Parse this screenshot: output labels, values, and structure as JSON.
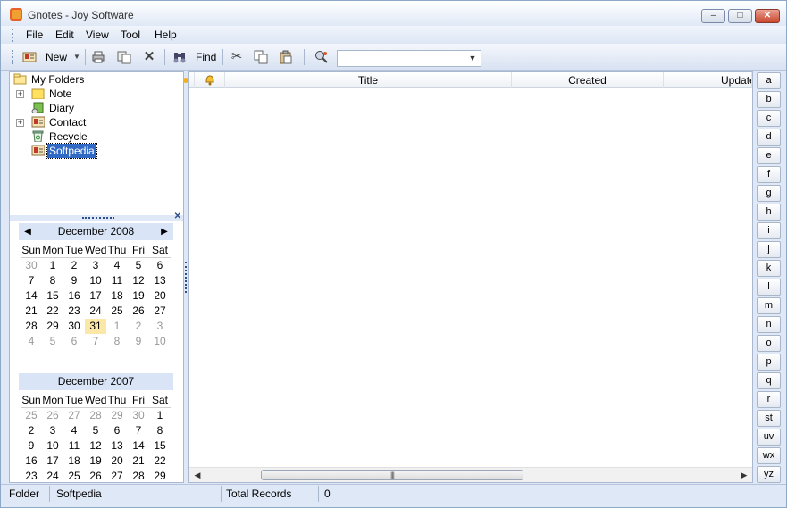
{
  "window": {
    "title": "Gnotes - Joy Software"
  },
  "menu": [
    "File",
    "Edit",
    "View",
    "Tool",
    "Help"
  ],
  "toolbar": {
    "new_label": "New",
    "find_label": "Find",
    "combo_value": ""
  },
  "tree": {
    "root": "My Folders",
    "items": [
      {
        "label": "Note",
        "icon": "folder-icon",
        "expandable": true
      },
      {
        "label": "Diary",
        "icon": "diary-icon",
        "expandable": false
      },
      {
        "label": "Contact",
        "icon": "contact-card-icon",
        "expandable": true
      },
      {
        "label": "Recycle",
        "icon": "recycle-bin-icon",
        "expandable": false
      },
      {
        "label": "Softpedia",
        "icon": "contact-card-icon",
        "expandable": false,
        "selected": true
      }
    ]
  },
  "calendar": [
    {
      "month": "December 2008",
      "dow": [
        "Sun",
        "Mon",
        "Tue",
        "Wed",
        "Thu",
        "Fri",
        "Sat"
      ],
      "weeks": [
        [
          "30",
          "1",
          "2",
          "3",
          "4",
          "5",
          "6"
        ],
        [
          "7",
          "8",
          "9",
          "10",
          "11",
          "12",
          "13"
        ],
        [
          "14",
          "15",
          "16",
          "17",
          "18",
          "19",
          "20"
        ],
        [
          "21",
          "22",
          "23",
          "24",
          "25",
          "26",
          "27"
        ],
        [
          "28",
          "29",
          "30",
          "31",
          "1",
          "2",
          "3"
        ],
        [
          "4",
          "5",
          "6",
          "7",
          "8",
          "9",
          "10"
        ]
      ],
      "today": "31"
    },
    {
      "month": "December 2007",
      "dow": [
        "Sun",
        "Mon",
        "Tue",
        "Wed",
        "Thu",
        "Fri",
        "Sat"
      ],
      "weeks": [
        [
          "25",
          "26",
          "27",
          "28",
          "29",
          "30",
          "1"
        ],
        [
          "2",
          "3",
          "4",
          "5",
          "6",
          "7",
          "8"
        ],
        [
          "9",
          "10",
          "11",
          "12",
          "13",
          "14",
          "15"
        ],
        [
          "16",
          "17",
          "18",
          "19",
          "20",
          "21",
          "22"
        ],
        [
          "23",
          "24",
          "25",
          "26",
          "27",
          "28",
          "29"
        ]
      ]
    }
  ],
  "grid": {
    "columns": [
      "Title",
      "Created",
      "Updated"
    ]
  },
  "alpha": [
    "a",
    "b",
    "c",
    "d",
    "e",
    "f",
    "g",
    "h",
    "i",
    "j",
    "k",
    "l",
    "m",
    "n",
    "o",
    "p",
    "q",
    "r",
    "st",
    "uv",
    "wx",
    "yz"
  ],
  "status": {
    "folder_label": "Folder",
    "folder_value": "Softpedia",
    "records_label": "Total Records",
    "records_value": "0"
  },
  "colors": {
    "accent": "#316ac5",
    "chrome": "#dfe8f6",
    "today": "#fbe7a6"
  }
}
